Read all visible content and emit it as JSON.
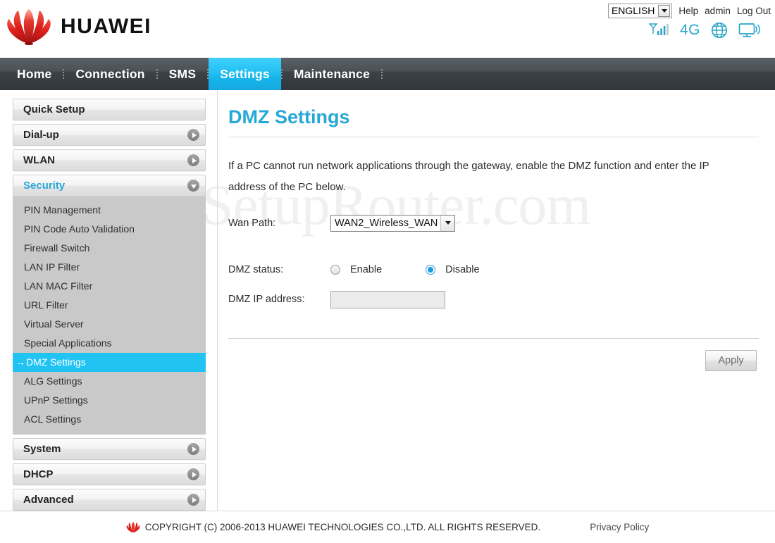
{
  "header": {
    "brand_name": "HUAWEI",
    "logo_icon": "huawei-flower-logo",
    "language": {
      "selected": "ENGLISH",
      "options": [
        "ENGLISH"
      ]
    },
    "links": [
      {
        "label": "Help",
        "name": "help-link"
      },
      {
        "label": "admin",
        "name": "admin-link"
      },
      {
        "label": "Log Out",
        "name": "logout-link"
      }
    ],
    "status_icons": [
      {
        "name": "signal-bars-icon",
        "label": ""
      },
      {
        "name": "network-type-label",
        "label": "4G"
      },
      {
        "name": "globe-icon",
        "label": ""
      },
      {
        "name": "device-connected-icon",
        "label": ""
      }
    ]
  },
  "nav": {
    "items": [
      {
        "label": "Home",
        "active": false
      },
      {
        "label": "Connection",
        "active": false
      },
      {
        "label": "SMS",
        "active": false
      },
      {
        "label": "Settings",
        "active": true
      },
      {
        "label": "Maintenance",
        "active": false
      }
    ]
  },
  "watermark": "SetupRouter.com",
  "sidebar": {
    "sections": [
      {
        "label": "Quick Setup",
        "state": "plain"
      },
      {
        "label": "Dial-up",
        "state": "collapsed"
      },
      {
        "label": "WLAN",
        "state": "collapsed"
      },
      {
        "label": "Security",
        "state": "expanded"
      },
      {
        "label": "System",
        "state": "collapsed"
      },
      {
        "label": "DHCP",
        "state": "collapsed"
      },
      {
        "label": "Advanced",
        "state": "collapsed"
      }
    ],
    "security_items": [
      {
        "label": "PIN Management",
        "selected": false
      },
      {
        "label": "PIN Code Auto Validation",
        "selected": false
      },
      {
        "label": "Firewall Switch",
        "selected": false
      },
      {
        "label": "LAN IP Filter",
        "selected": false
      },
      {
        "label": "LAN MAC Filter",
        "selected": false
      },
      {
        "label": "URL Filter",
        "selected": false
      },
      {
        "label": "Virtual Server",
        "selected": false
      },
      {
        "label": "Special Applications",
        "selected": false
      },
      {
        "label": "DMZ Settings",
        "selected": true,
        "prefix": "→"
      },
      {
        "label": "ALG Settings",
        "selected": false
      },
      {
        "label": "UPnP Settings",
        "selected": false
      },
      {
        "label": "ACL Settings",
        "selected": false
      }
    ]
  },
  "main": {
    "title": "DMZ Settings",
    "description": "If a PC cannot run network applications through the gateway, enable the DMZ function and enter the IP address of the PC below.",
    "wan_path": {
      "label": "Wan Path:",
      "selected": "WAN2_Wireless_WAN",
      "options": [
        "WAN2_Wireless_WAN"
      ]
    },
    "dmz_status": {
      "label": "DMZ status:",
      "enable_label": "Enable",
      "disable_label": "Disable",
      "selected": "Disable"
    },
    "dmz_ip": {
      "label": "DMZ IP address:",
      "value": "",
      "placeholder": ""
    },
    "apply_label": "Apply"
  },
  "footer": {
    "copyright": "COPYRIGHT (C) 2006-2013 HUAWEI TECHNOLOGIES CO.,LTD. ALL RIGHTS RESERVED.",
    "privacy_label": "Privacy Policy",
    "logo_icon": "huawei-mini-logo"
  },
  "colors": {
    "accent": "#27a9d8",
    "highlight": "#21c3f3",
    "nav_bg": "#434a4f",
    "brand_red": "#d6221f",
    "submenu_bg": "#c9c9c9"
  }
}
